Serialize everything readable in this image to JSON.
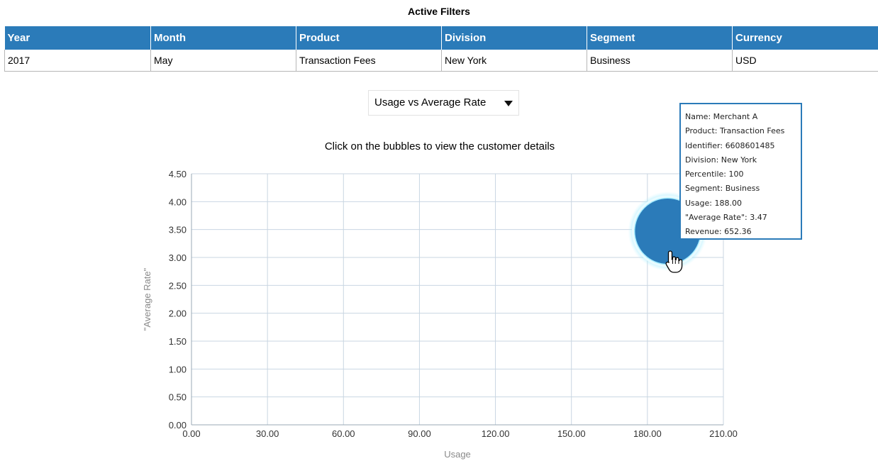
{
  "filters": {
    "title": "Active Filters",
    "headers": [
      "Year",
      "Month",
      "Product",
      "Division",
      "Segment",
      "Currency"
    ],
    "values": [
      "2017",
      "May",
      "Transaction Fees",
      "New York",
      "Business",
      "USD"
    ]
  },
  "chart_selector": {
    "selected": "Usage vs Average Rate"
  },
  "instructions": "Click on the bubbles to view the customer details",
  "chart_data": {
    "type": "scatter",
    "title": "",
    "xlabel": "Usage",
    "ylabel": "\"Average Rate\"",
    "xlim": [
      0,
      210
    ],
    "ylim": [
      0,
      4.5
    ],
    "x_ticks": [
      "0.00",
      "30.00",
      "60.00",
      "90.00",
      "120.00",
      "150.00",
      "180.00",
      "210.00"
    ],
    "y_ticks": [
      "0.00",
      "0.50",
      "1.00",
      "1.50",
      "2.00",
      "2.50",
      "3.00",
      "3.50",
      "4.00",
      "4.50"
    ],
    "grid": true,
    "bubble_color": "#2b7bb9",
    "series": [
      {
        "points": [
          {
            "x": 188.0,
            "y": 3.47,
            "size": 652.36
          }
        ]
      }
    ]
  },
  "tooltip": {
    "lines": [
      "Name: Merchant A",
      "Product: Transaction Fees",
      "Identifier: 6608601485",
      "Division: New York",
      "Percentile: 100",
      "Segment: Business",
      "Usage: 188.00",
      "\"Average Rate\": 3.47",
      "Revenue: 652.36"
    ]
  }
}
